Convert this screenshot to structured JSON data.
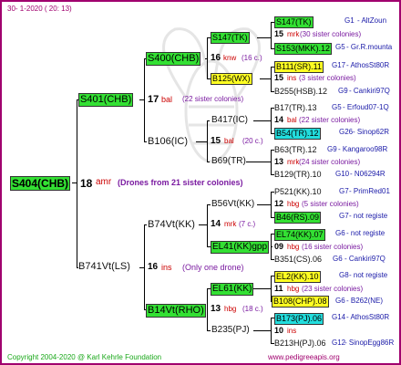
{
  "header": {
    "date": "30- 1-2020 ( 20: 13)"
  },
  "footer": {
    "copyright": "Copyright 2004-2020 @ Karl Kehrle Foundation",
    "site": "www.pedigreeapis.org"
  },
  "root": {
    "id": "S404(CHB)",
    "num": "18",
    "code": "amr",
    "note": "(Drones from 21 sister colonies)"
  },
  "s401": {
    "id": "S401(CHB)",
    "num": "17",
    "code": "bal",
    "note": "(22 sister colonies)"
  },
  "s400": {
    "id": "S400(CHB)",
    "num": "16",
    "code": "knw",
    "note": "(16 c.)"
  },
  "s147": {
    "id": "S147(TK)",
    "num": "15",
    "code": "mrk",
    "note": "(30 sister colonies)",
    "right_gen": "G1",
    "right_name": "- AltZoun"
  },
  "s153": {
    "id": "S153(MKK).12",
    "right_gen": "G5",
    "right_name": "- Gr.R.mounta"
  },
  "b125": {
    "id": "B125(WX)",
    "num": "15",
    "code": "ins",
    "note": "(3 sister colonies)"
  },
  "b111": {
    "id": "B111(SR).11",
    "right_gen": "G17",
    "right_name": "- AthosSt80R"
  },
  "b255": {
    "id": "B255(HSB).12",
    "right_gen": "G9",
    "right_name": "- Cankiri97Q"
  },
  "b106": {
    "id": "B106(IC)",
    "num": "15",
    "code": "bal",
    "note": "(20 c.)"
  },
  "b417": {
    "id": "B417(IC)",
    "num": "14",
    "code": "bal",
    "note": "(22 sister colonies)"
  },
  "b17": {
    "id": "B17(TR).13",
    "right_gen": "G5",
    "right_name": "- Erfoud07-1Q"
  },
  "b54": {
    "id": "B54(TR).12",
    "right_gen": "G26",
    "right_name": "- Sinop62R"
  },
  "b69": {
    "id": "B69(TR)",
    "num": "13",
    "code": "mrk",
    "note": "(24 sister colonies)"
  },
  "b63": {
    "id": "B63(TR).12",
    "right_gen": "G9",
    "right_name": "- Kangaroo98R"
  },
  "b129": {
    "id": "B129(TR).10",
    "right_gen": "G10",
    "right_name": "- N06294R"
  },
  "b741": {
    "id": "B741Vt(LS)",
    "num": "16",
    "code": "ins",
    "note": "(Only one drone)"
  },
  "b74": {
    "id": "B74Vt(KK)",
    "num": "14",
    "code": "mrk",
    "note": "(7 c.)"
  },
  "b56": {
    "id": "B56Vt(KK)",
    "num": "12",
    "code": "hbg",
    "note": "(5 sister colonies)"
  },
  "p521": {
    "id": "P521(KK).10",
    "right_gen": "G7",
    "right_name": "- PrimRed01"
  },
  "b46": {
    "id": "B46(RS).09",
    "right_gen": "G7",
    "right_name": "- not registe"
  },
  "el41": {
    "id": "EL41(KK)gpp",
    "num": "09",
    "code": "hbg",
    "note": "(16 sister colonies)"
  },
  "el74": {
    "id": "EL74(KK).07",
    "right_gen": "G6",
    "right_name": "- not registe"
  },
  "b351": {
    "id": "B351(CS).06",
    "right_gen": "G6",
    "right_name": "- Cankiri97Q"
  },
  "b14": {
    "id": "B14Vt(RHO)",
    "num": "13",
    "code": "hbg",
    "note": "(18 c.)"
  },
  "el61": {
    "id": "EL61(KK)",
    "num": "11",
    "code": "hbg",
    "note": "(23 sister colonies)"
  },
  "el2": {
    "id": "EL2(KK).10",
    "right_gen": "G8",
    "right_name": "- not registe"
  },
  "b108": {
    "id": "B108(CHP).08",
    "right_gen": "G6",
    "right_name": "- B262(NE)"
  },
  "b235": {
    "id": "B235(PJ)",
    "num": "10",
    "code": "ins"
  },
  "b173": {
    "id": "B173(PJ).06",
    "right_gen": "G14",
    "right_name": "- AthosSt80R"
  },
  "b213": {
    "id": "B213H(PJ).06",
    "right_gen": "G12",
    "right_name": "- SinopEgg86R"
  }
}
